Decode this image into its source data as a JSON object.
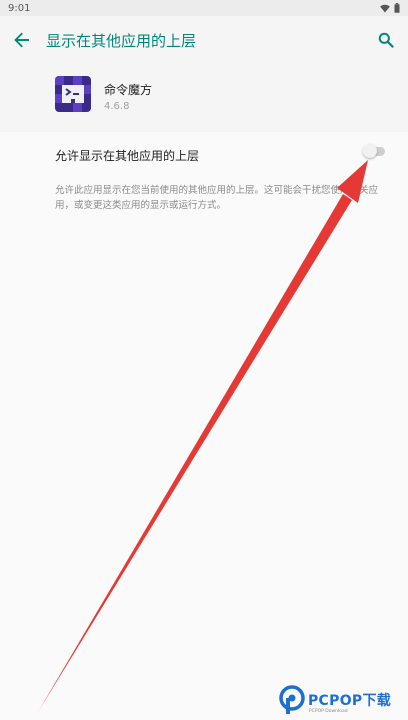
{
  "status_bar": {
    "time": "9:01"
  },
  "app_bar": {
    "title": "显示在其他应用的上层"
  },
  "app_info": {
    "name": "命令魔方",
    "version": "4.6.8"
  },
  "preference": {
    "label": "允许显示在其他应用的上层",
    "summary": "允许此应用显示在您当前使用的其他应用的上层。这可能会干扰您使用相关应用，或变更这类应用的显示或运行方式。",
    "enabled": false
  },
  "watermark": {
    "text": "PCPOP下载",
    "sub": "PCPOP Download"
  },
  "colors": {
    "accent": "#00897b",
    "arrow": "#e53935",
    "watermark": "#1f6fd1"
  },
  "icons": [
    "back-arrow-icon",
    "search-icon",
    "wifi-icon",
    "battery-icon",
    "app-icon"
  ]
}
